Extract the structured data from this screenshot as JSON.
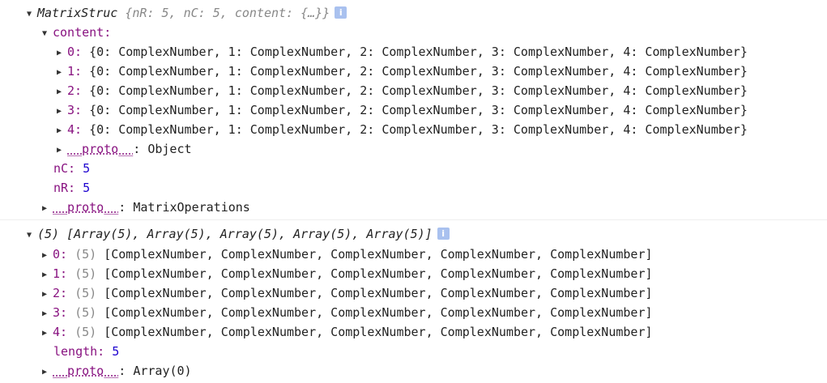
{
  "entry1": {
    "summary": {
      "class_name": "MatrixStruc",
      "preview": "{nR: 5, nC: 5, content: {…}}"
    },
    "content_key": "content:",
    "rows": [
      {
        "index": "0:",
        "value": "{0: ComplexNumber, 1: ComplexNumber, 2: ComplexNumber, 3: ComplexNumber, 4: ComplexNumber}"
      },
      {
        "index": "1:",
        "value": "{0: ComplexNumber, 1: ComplexNumber, 2: ComplexNumber, 3: ComplexNumber, 4: ComplexNumber}"
      },
      {
        "index": "2:",
        "value": "{0: ComplexNumber, 1: ComplexNumber, 2: ComplexNumber, 3: ComplexNumber, 4: ComplexNumber}"
      },
      {
        "index": "3:",
        "value": "{0: ComplexNumber, 1: ComplexNumber, 2: ComplexNumber, 3: ComplexNumber, 4: ComplexNumber}"
      },
      {
        "index": "4:",
        "value": "{0: ComplexNumber, 1: ComplexNumber, 2: ComplexNumber, 3: ComplexNumber, 4: ComplexNumber}"
      }
    ],
    "content_proto": {
      "key": "__proto__",
      "value": ": Object"
    },
    "nC": {
      "key": "nC:",
      "value": "5"
    },
    "nR": {
      "key": "nR:",
      "value": "5"
    },
    "proto": {
      "key": "__proto__",
      "value": ": MatrixOperations"
    }
  },
  "entry2": {
    "summary": "(5) [Array(5), Array(5), Array(5), Array(5), Array(5)]",
    "rows": [
      {
        "index": "0:",
        "count": "(5)",
        "value": "[ComplexNumber, ComplexNumber, ComplexNumber, ComplexNumber, ComplexNumber]"
      },
      {
        "index": "1:",
        "count": "(5)",
        "value": "[ComplexNumber, ComplexNumber, ComplexNumber, ComplexNumber, ComplexNumber]"
      },
      {
        "index": "2:",
        "count": "(5)",
        "value": "[ComplexNumber, ComplexNumber, ComplexNumber, ComplexNumber, ComplexNumber]"
      },
      {
        "index": "3:",
        "count": "(5)",
        "value": "[ComplexNumber, ComplexNumber, ComplexNumber, ComplexNumber, ComplexNumber]"
      },
      {
        "index": "4:",
        "count": "(5)",
        "value": "[ComplexNumber, ComplexNumber, ComplexNumber, ComplexNumber, ComplexNumber]"
      }
    ],
    "length": {
      "key": "length:",
      "value": "5"
    },
    "proto": {
      "key": "__proto__",
      "value": ": Array(0)"
    }
  },
  "icons": {
    "expanded": "▼",
    "collapsed": "▶",
    "info": "i"
  },
  "colors": {
    "key": "#881280",
    "number": "#1c00cf",
    "dim": "#888888",
    "info_badge": "#a9c1ef"
  }
}
